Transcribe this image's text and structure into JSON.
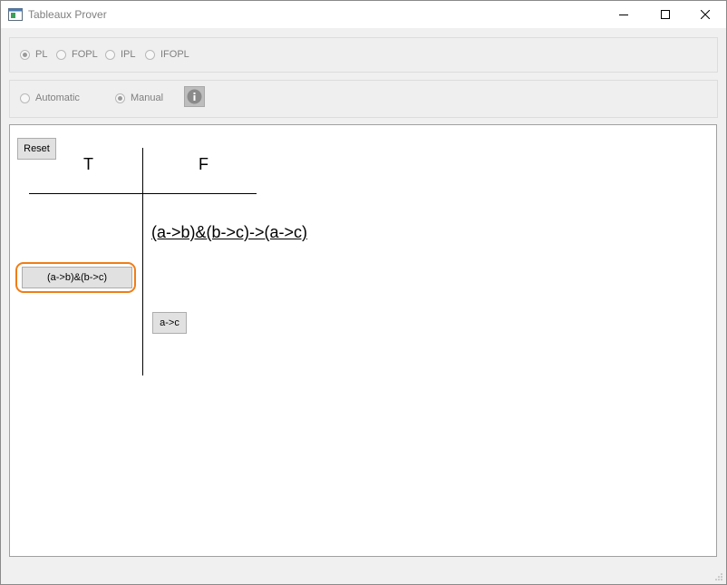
{
  "window": {
    "title": "Tableaux Prover",
    "controls": [
      "minimize",
      "maximize",
      "close"
    ]
  },
  "logic_selector": {
    "options": [
      {
        "label": "PL",
        "checked": true
      },
      {
        "label": "FOPL",
        "checked": false
      },
      {
        "label": "IPL",
        "checked": false
      },
      {
        "label": "IFOPL",
        "checked": false
      }
    ]
  },
  "mode_selector": {
    "options": [
      {
        "label": "Automatic",
        "checked": false
      },
      {
        "label": "Manual",
        "checked": true
      }
    ],
    "info_icon": "info-icon"
  },
  "tableau": {
    "reset_label": "Reset",
    "true_header": "T",
    "false_header": "F",
    "root_formula": "(a->b)&(b->c)->(a->c)",
    "true_nodes": [
      "(a->b)&(b->c)"
    ],
    "false_nodes": [
      "a->c"
    ],
    "highlight_color": "#f07d18"
  }
}
